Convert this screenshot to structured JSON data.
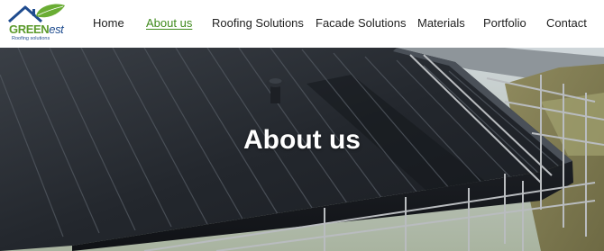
{
  "brand": {
    "name_green": "GREEN",
    "name_blue": "est",
    "tagline": "Roofing solutions",
    "colors": {
      "green": "#5b9a2b",
      "blue": "#1f4c8f"
    }
  },
  "nav": {
    "items": [
      {
        "label": "Home"
      },
      {
        "label": "About us",
        "active": true
      },
      {
        "label": "Roofing Solutions"
      },
      {
        "label": "Facade Solutions"
      },
      {
        "label": "Materials"
      },
      {
        "label": "Portfolio"
      },
      {
        "label": "Contact"
      }
    ],
    "active_color": "#3f8a1c"
  },
  "hero": {
    "title": "About us",
    "image": "dark-metal-roof-with-scaffolding"
  }
}
